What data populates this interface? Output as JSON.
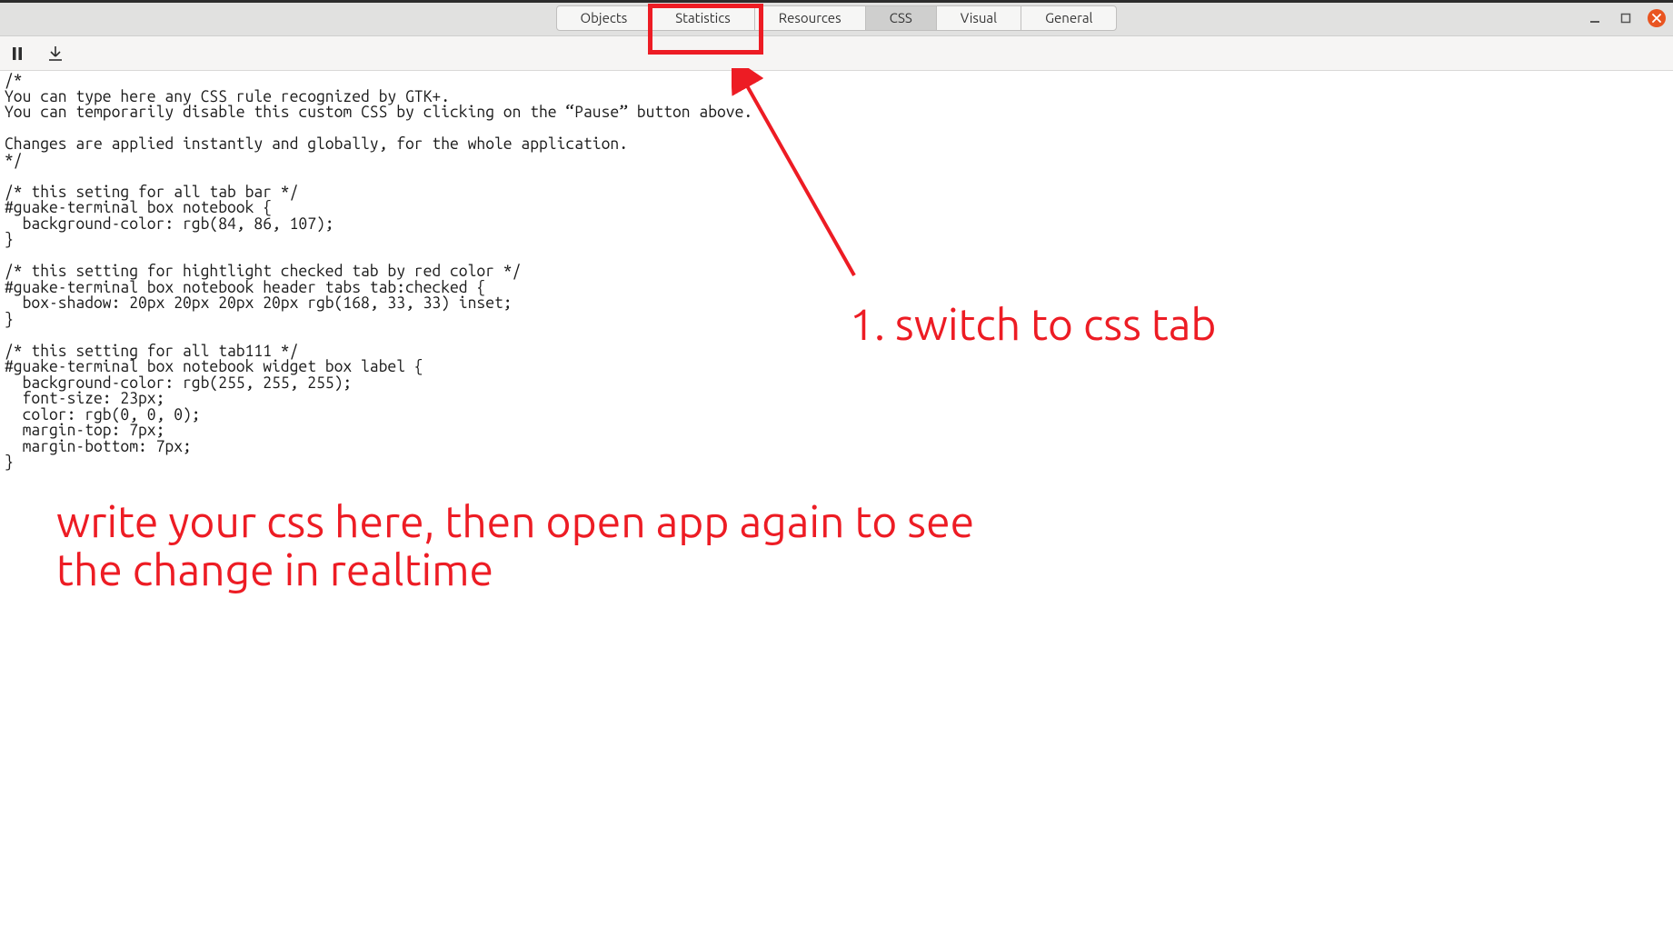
{
  "tabs": {
    "objects": "Objects",
    "statistics": "Statistics",
    "resources": "Resources",
    "css": "CSS",
    "visual": "Visual",
    "general": "General"
  },
  "editor_text": "/*\nYou can type here any CSS rule recognized by GTK+.\nYou can temporarily disable this custom CSS by clicking on the “Pause” button above.\n\nChanges are applied instantly and globally, for the whole application.\n*/\n\n/* this seting for all tab bar */\n#guake-terminal box notebook {\n  background-color: rgb(84, 86, 107);\n}\n\n/* this setting for hightlight checked tab by red color */\n#guake-terminal box notebook header tabs tab:checked {\n  box-shadow: 20px 20px 20px 20px rgb(168, 33, 33) inset;\n}\n\n/* this setting for all tab111 */\n#guake-terminal box notebook widget box label {\n  background-color: rgb(255, 255, 255);\n  font-size: 23px;\n  color: rgb(0, 0, 0);\n  margin-top: 7px;\n  margin-bottom: 7px;\n}",
  "annotations": {
    "step1": "1. switch to css tab",
    "instruction": "write your css here, then open app again to see\nthe change in realtime"
  }
}
